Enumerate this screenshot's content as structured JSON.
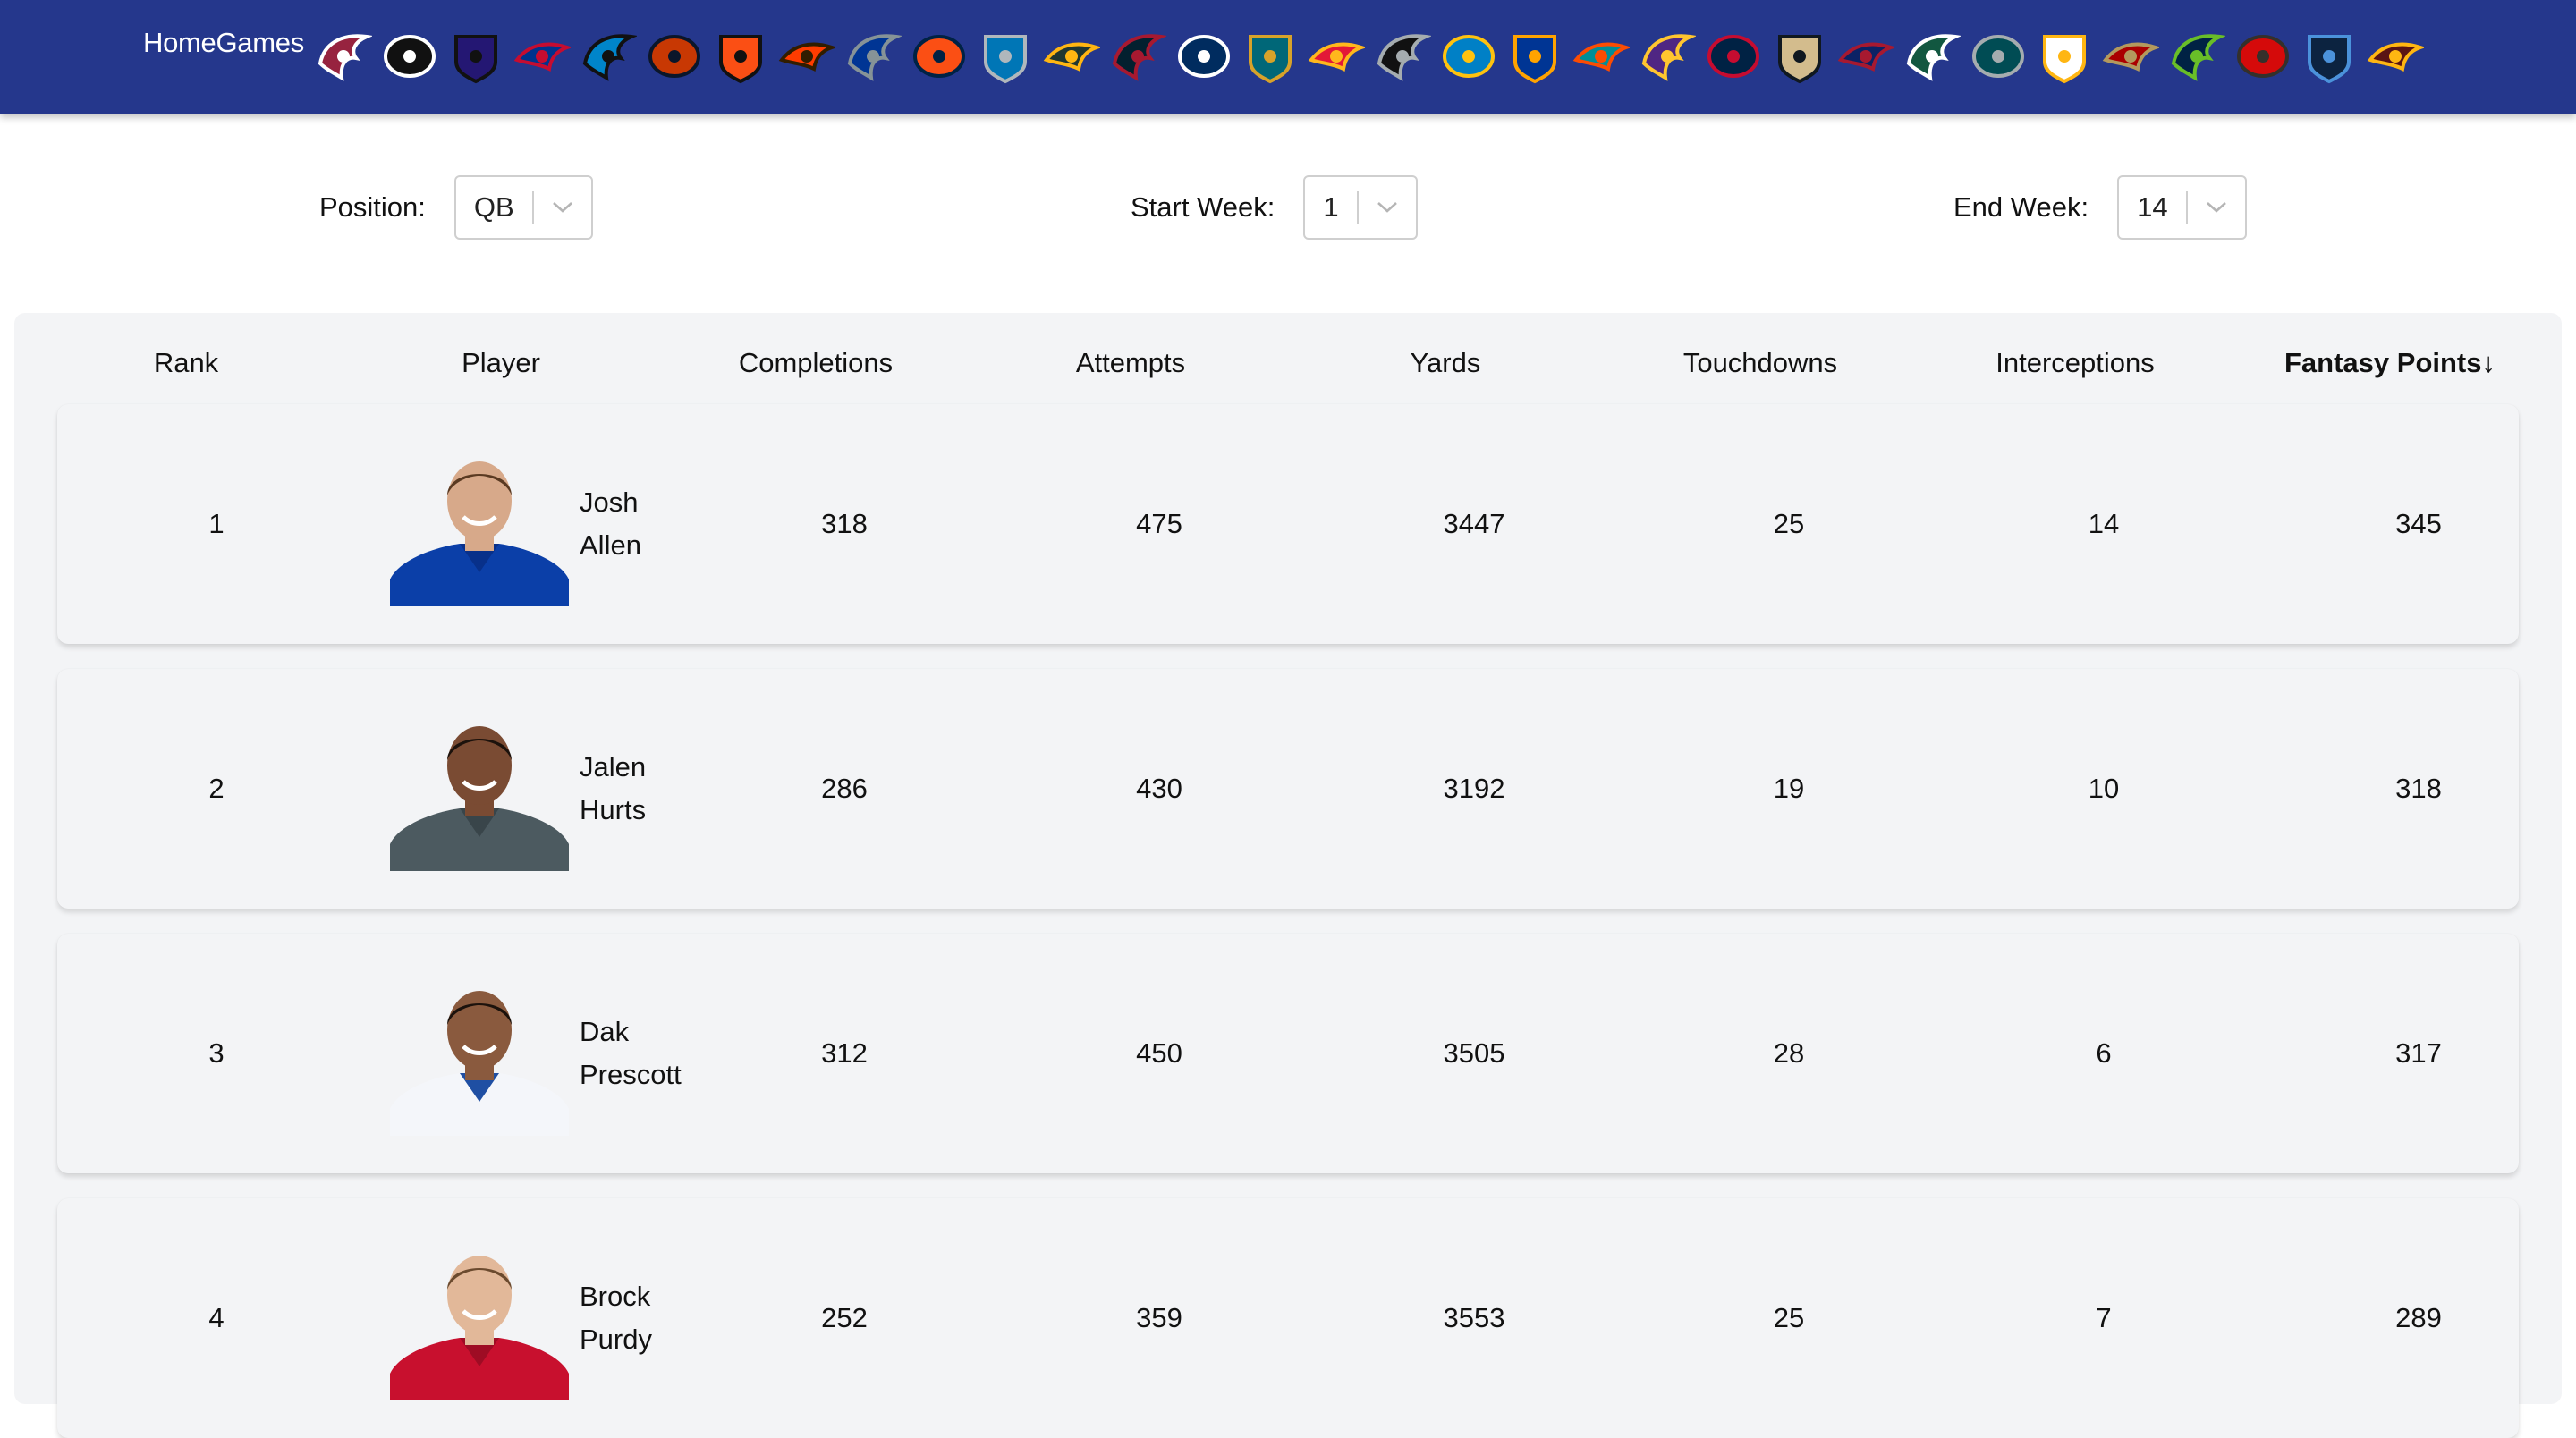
{
  "header": {
    "home_label": "HomeGames",
    "bar_color": "#25378c",
    "teams": [
      {
        "name": "cardinals-icon",
        "c1": "#97233f",
        "c2": "#ffffff"
      },
      {
        "name": "falcons-icon",
        "c1": "#111111",
        "c2": "#ffffff"
      },
      {
        "name": "ravens-icon",
        "c1": "#241773",
        "c2": "#111111"
      },
      {
        "name": "bills-icon",
        "c1": "#00338d",
        "c2": "#c60c30"
      },
      {
        "name": "panthers-icon",
        "c1": "#0085ca",
        "c2": "#111111"
      },
      {
        "name": "bears-icon",
        "c1": "#c83803",
        "c2": "#0b162a"
      },
      {
        "name": "bengals-icon",
        "c1": "#fb4f14",
        "c2": "#111111"
      },
      {
        "name": "browns-icon",
        "c1": "#ff3c00",
        "c2": "#311d00"
      },
      {
        "name": "cowboys-icon",
        "c1": "#003594",
        "c2": "#869397"
      },
      {
        "name": "broncos-icon",
        "c1": "#fb4f14",
        "c2": "#002244"
      },
      {
        "name": "lions-icon",
        "c1": "#0076b6",
        "c2": "#b0b7bc"
      },
      {
        "name": "packers-icon",
        "c1": "#203731",
        "c2": "#ffb612"
      },
      {
        "name": "texans-icon",
        "c1": "#03202f",
        "c2": "#a71930"
      },
      {
        "name": "colts-icon",
        "c1": "#002c5f",
        "c2": "#ffffff"
      },
      {
        "name": "jaguars-icon",
        "c1": "#006778",
        "c2": "#d7a22a"
      },
      {
        "name": "chiefs-icon",
        "c1": "#e31837",
        "c2": "#ffb81c"
      },
      {
        "name": "raiders-icon",
        "c1": "#111111",
        "c2": "#a5acaf"
      },
      {
        "name": "chargers-icon",
        "c1": "#0080c6",
        "c2": "#ffc20e"
      },
      {
        "name": "rams-icon",
        "c1": "#003594",
        "c2": "#ffa300"
      },
      {
        "name": "dolphins-icon",
        "c1": "#008e97",
        "c2": "#fc4c02"
      },
      {
        "name": "vikings-icon",
        "c1": "#4f2683",
        "c2": "#ffc62f"
      },
      {
        "name": "patriots-icon",
        "c1": "#002244",
        "c2": "#c60c30"
      },
      {
        "name": "saints-icon",
        "c1": "#d3bc8d",
        "c2": "#101820"
      },
      {
        "name": "giants-icon",
        "c1": "#0b2265",
        "c2": "#a71930"
      },
      {
        "name": "jets-icon",
        "c1": "#125740",
        "c2": "#ffffff"
      },
      {
        "name": "eagles-icon",
        "c1": "#004c54",
        "c2": "#a5acaf"
      },
      {
        "name": "steelers-icon",
        "c1": "#ffffff",
        "c2": "#ffb612"
      },
      {
        "name": "49ers-icon",
        "c1": "#aa0000",
        "c2": "#b3995d"
      },
      {
        "name": "seahawks-icon",
        "c1": "#002244",
        "c2": "#69be28"
      },
      {
        "name": "buccaneers-icon",
        "c1": "#d50a0a",
        "c2": "#34302b"
      },
      {
        "name": "titans-icon",
        "c1": "#0c2340",
        "c2": "#4b92db"
      },
      {
        "name": "commanders-icon",
        "c1": "#5a1414",
        "c2": "#ffb612"
      }
    ]
  },
  "filters": {
    "position": {
      "label": "Position:",
      "value": "QB"
    },
    "start_week": {
      "label": "Start Week:",
      "value": "1"
    },
    "end_week": {
      "label": "End Week:",
      "value": "14"
    }
  },
  "table": {
    "columns": [
      "Rank",
      "Player",
      "Completions",
      "Attempts",
      "Yards",
      "Touchdowns",
      "Interceptions",
      "Fantasy Points↓"
    ],
    "rows": [
      {
        "rank": "1",
        "first": "Josh",
        "last": "Allen",
        "completions": "318",
        "attempts": "475",
        "yards": "3447",
        "touchdowns": "25",
        "interceptions": "14",
        "fantasy_points": "345",
        "jersey": "#0b3fa8",
        "jersey_dark": "#08308a",
        "skin": "#d7a98a",
        "hair": "#5a3a22"
      },
      {
        "rank": "2",
        "first": "Jalen",
        "last": "Hurts",
        "completions": "286",
        "attempts": "430",
        "yards": "3192",
        "touchdowns": "19",
        "interceptions": "10",
        "fantasy_points": "318",
        "jersey": "#4c5a60",
        "jersey_dark": "#39454a",
        "skin": "#7a4b33",
        "hair": "#1c120c"
      },
      {
        "rank": "3",
        "first": "Dak",
        "last": "Prescott",
        "completions": "312",
        "attempts": "450",
        "yards": "3505",
        "touchdowns": "28",
        "interceptions": "6",
        "fantasy_points": "317",
        "jersey": "#f4f6fa",
        "jersey_dark": "#1f4fa3",
        "skin": "#8a5a3e",
        "hair": "#1c120c"
      },
      {
        "rank": "4",
        "first": "Brock",
        "last": "Purdy",
        "completions": "252",
        "attempts": "359",
        "yards": "3553",
        "touchdowns": "25",
        "interceptions": "7",
        "fantasy_points": "289",
        "jersey": "#c8102e",
        "jersey_dark": "#9e0c24",
        "skin": "#e2b899",
        "hair": "#6b4a2e"
      }
    ]
  }
}
